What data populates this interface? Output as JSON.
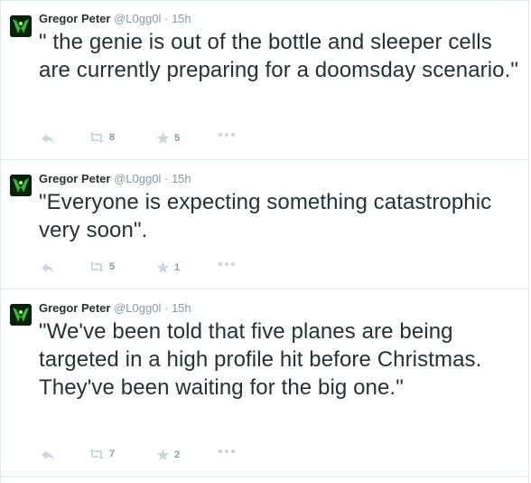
{
  "tweets": [
    {
      "fullname": "Gregor Peter",
      "username": "@L0gg0l",
      "separator": "·",
      "time": "15h",
      "text": "\" the genie is out of the bottle and sleeper cells are currently preparing for a doomsday scenario.\"",
      "retweets": "8",
      "favorites": "5"
    },
    {
      "fullname": "Gregor Peter",
      "username": "@L0gg0l",
      "separator": "·",
      "time": "15h",
      "text": "\"Everyone is expecting something catastrophic very soon\".",
      "retweets": "5",
      "favorites": "1"
    },
    {
      "fullname": "Gregor Peter",
      "username": "@L0gg0l",
      "separator": "·",
      "time": "15h",
      "text": "\"We've been told that five planes are being targeted in a high profile hit before Christmas. They've been waiting for the big one.\"",
      "retweets": "7",
      "favorites": "2"
    }
  ],
  "icons": {
    "reply": "reply-icon",
    "retweet": "retweet-icon",
    "favorite": "star-icon",
    "more": "more-dots-icon"
  },
  "colors": {
    "text": "#292f33",
    "muted": "#8899a6",
    "icon": "#ccd6dd",
    "border": "#e1e8ed"
  }
}
